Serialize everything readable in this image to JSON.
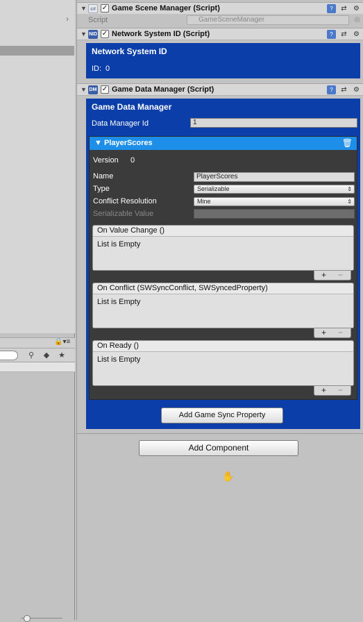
{
  "left_panel": {
    "chevron": "›",
    "lock": "🔒▾≡"
  },
  "components": [
    {
      "title": "Game Scene Manager (Script)",
      "icon_text": "c#",
      "script_label": "Script",
      "script_value": "GameSceneManager",
      "checked": "✓"
    },
    {
      "title": "Network System ID (Script)",
      "icon_text": "NID",
      "heading": "Network System ID",
      "id_label": "ID:",
      "id_value": "0",
      "checked": "✓"
    },
    {
      "title": "Game Data Manager (Script)",
      "icon_text": "DM",
      "heading": "Game Data Manager",
      "data_manager_id_label": "Data Manager Id",
      "data_manager_id_value": "1",
      "checked": "✓"
    }
  ],
  "player_scores": {
    "header": "▼ PlayerScores",
    "version_label": "Version",
    "version_value": "0",
    "name_label": "Name",
    "name_value": "PlayerScores",
    "type_label": "Type",
    "type_value": "Serializable",
    "conflict_label": "Conflict Resolution",
    "conflict_value": "Mine",
    "serializable_label": "Serializable Value",
    "events": [
      {
        "title": "On Value Change ()",
        "empty": "List is Empty"
      },
      {
        "title": "On Conflict (SWSyncConflict, SWSyncedProperty)",
        "empty": "List is Empty"
      },
      {
        "title": "On Ready ()",
        "empty": "List is Empty"
      }
    ],
    "plus": "+",
    "minus": "−"
  },
  "buttons": {
    "add_game_sync_property": "Add Game Sync Property",
    "add_component": "Add Component"
  },
  "colors": {
    "blue_panel": "#0b3ea8",
    "player_header": "#1e8fe8",
    "dark_panel": "#3b3b3b",
    "inspector_bg": "#c2c2c2"
  },
  "icons": [
    "help-book-icon",
    "preset-sliders-icon",
    "gear-icon",
    "trash-icon",
    "lock-icon",
    "hand-cursor-icon",
    "object-picker-icon"
  ]
}
